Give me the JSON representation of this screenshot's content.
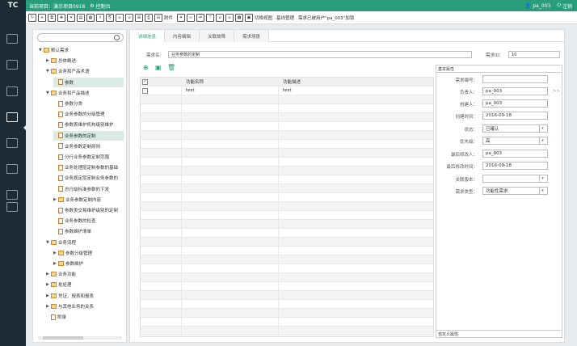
{
  "topbar": {
    "logo": "TC",
    "project": "当前项目：演示项目0918",
    "console": "控制台",
    "user": "pa_003",
    "logout": "注销"
  },
  "toolbar": {
    "attachment": "附件",
    "switch_view": "切换视图",
    "baseline_mgmt": "基线管理",
    "lock_info": "需求已被用户\"pa_003\"加锁"
  },
  "tree": {
    "search_placeholder": "",
    "nodes": [
      {
        "label": "默认需求",
        "level": 0,
        "arrow": "▼",
        "type": "folder"
      },
      {
        "label": "总体概述",
        "level": 1,
        "arrow": "▶",
        "type": "folder"
      },
      {
        "label": "业务和产品术语",
        "level": 1,
        "arrow": "▼",
        "type": "folder"
      },
      {
        "label": "参数",
        "level": 2,
        "arrow": "",
        "type": "doc",
        "selected": true
      },
      {
        "label": "业务和产品描述",
        "level": 1,
        "arrow": "▼",
        "type": "folder"
      },
      {
        "label": "参数分类",
        "level": 2,
        "arrow": "",
        "type": "doc"
      },
      {
        "label": "业务参数的分级管理",
        "level": 2,
        "arrow": "",
        "type": "doc"
      },
      {
        "label": "参数表维护机构级别维护",
        "level": 2,
        "arrow": "",
        "type": "doc"
      },
      {
        "label": "业务参数的定制",
        "level": 2,
        "arrow": "",
        "type": "doc",
        "selected": true
      },
      {
        "label": "业务参数定制原则",
        "level": 2,
        "arrow": "",
        "type": "doc"
      },
      {
        "label": "分行业务参数定制范围",
        "level": 2,
        "arrow": "",
        "type": "doc"
      },
      {
        "label": "业务处理层定制参数的基础",
        "level": 2,
        "arrow": "",
        "type": "doc"
      },
      {
        "label": "业务规定层定制业务参数的",
        "level": 2,
        "arrow": "",
        "type": "doc"
      },
      {
        "label": "总行级标准参数的下发",
        "level": 2,
        "arrow": "",
        "type": "doc"
      },
      {
        "label": "业务参数定制内容",
        "level": 2,
        "arrow": "▶",
        "type": "folder"
      },
      {
        "label": "参数类交易维护级别的定制",
        "level": 2,
        "arrow": "",
        "type": "doc"
      },
      {
        "label": "业务参数的检查",
        "level": 2,
        "arrow": "",
        "type": "doc"
      },
      {
        "label": "参数维护清单",
        "level": 2,
        "arrow": "",
        "type": "doc"
      },
      {
        "label": "业务流程",
        "level": 1,
        "arrow": "▼",
        "type": "folder"
      },
      {
        "label": "参数分级管理",
        "level": 2,
        "arrow": "▶",
        "type": "folder"
      },
      {
        "label": "参数维护",
        "level": 2,
        "arrow": "▶",
        "type": "folder"
      },
      {
        "label": "业务功能",
        "level": 1,
        "arrow": "▶",
        "type": "folder"
      },
      {
        "label": "批处理",
        "level": 1,
        "arrow": "▶",
        "type": "folder"
      },
      {
        "label": "凭证、报表和报表",
        "level": 1,
        "arrow": "▶",
        "type": "folder"
      },
      {
        "label": "与其他业务的关系",
        "level": 1,
        "arrow": "▶",
        "type": "folder"
      },
      {
        "label": "附录",
        "level": 1,
        "arrow": "",
        "type": "doc"
      }
    ]
  },
  "tabs": [
    "详细信息",
    "内容编辑",
    "关联故障",
    "需求场景"
  ],
  "form": {
    "name_label": "需求名:",
    "name_value": "业务参数的定制",
    "id_label": "需求ID:",
    "id_value": "10"
  },
  "grid": {
    "col1": "功能名称",
    "col2": "功能描述",
    "rows": [
      {
        "name": "test",
        "desc": "test"
      }
    ]
  },
  "props": {
    "header": "基本属性",
    "footer": "自定义属性",
    "fields": [
      {
        "label": "需求编号：",
        "value": "",
        "dropdown": false
      },
      {
        "label": "负责人：",
        "value": "pa_003",
        "dropdown": false,
        "extra": ">>"
      },
      {
        "label": "创建人：",
        "value": "pa_003",
        "dropdown": false
      },
      {
        "label": "创建时间：",
        "value": "2016-09-18",
        "dropdown": false
      },
      {
        "label": "状态：",
        "value": "已確认",
        "dropdown": true
      },
      {
        "label": "优先级：",
        "value": "高",
        "dropdown": true
      },
      {
        "label": "最后修改人：",
        "value": "pa_003",
        "dropdown": false
      },
      {
        "label": "最后修改时间：",
        "value": "2016-09-18",
        "dropdown": false
      },
      {
        "label": "关联版本：",
        "value": "",
        "dropdown": true
      },
      {
        "label": "需求类型：",
        "value": "功能性需求",
        "dropdown": true
      }
    ]
  },
  "colors": {
    "accent": "#2a9d7b",
    "sidebar": "#1d2b36"
  }
}
